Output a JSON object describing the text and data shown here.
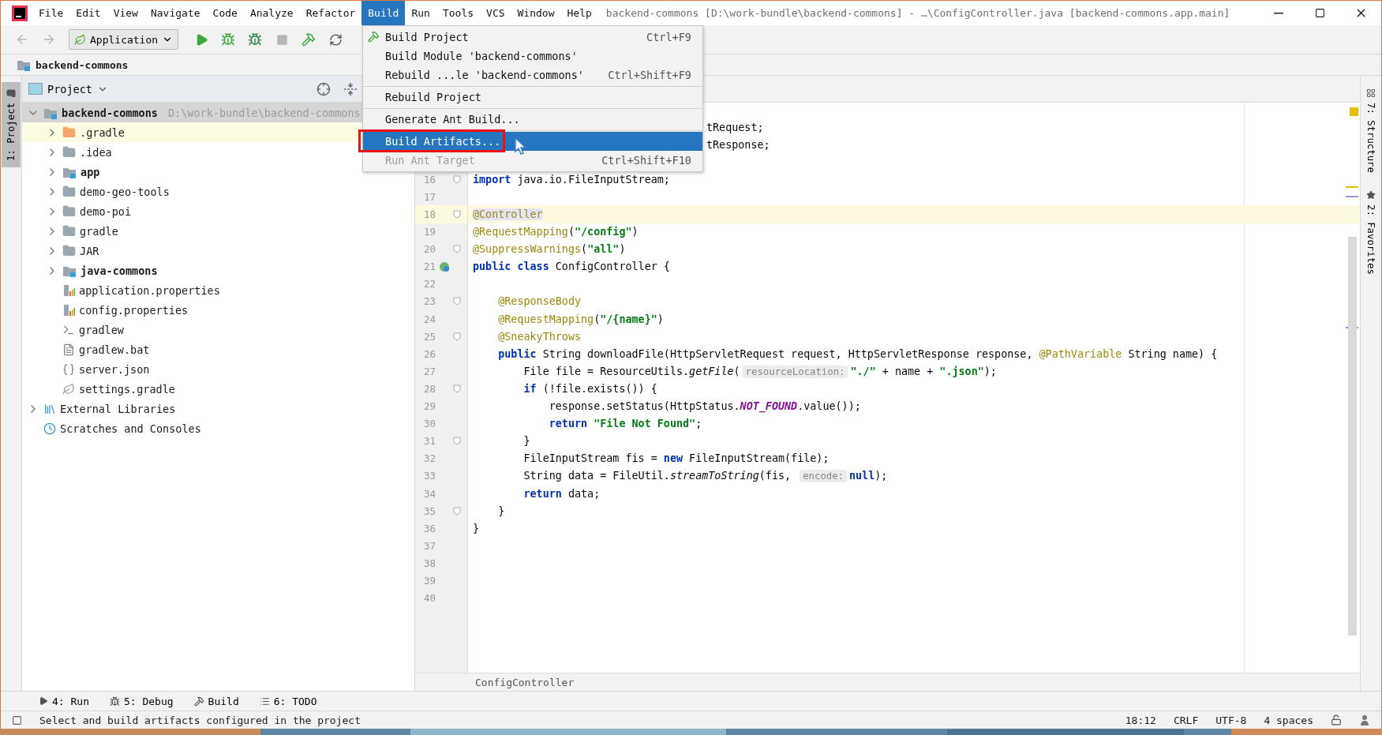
{
  "window": {
    "title": "backend-commons [D:\\work-bundle\\backend-commons] - …\\ConfigController.java [backend-commons.app.main]"
  },
  "menu_bar": [
    {
      "label": "File",
      "selected": false
    },
    {
      "label": "Edit",
      "selected": false
    },
    {
      "label": "View",
      "selected": false
    },
    {
      "label": "Navigate",
      "selected": false
    },
    {
      "label": "Code",
      "selected": false
    },
    {
      "label": "Analyze",
      "selected": false
    },
    {
      "label": "Refactor",
      "selected": false
    },
    {
      "label": "Build",
      "selected": true
    },
    {
      "label": "Run",
      "selected": false
    },
    {
      "label": "Tools",
      "selected": false
    },
    {
      "label": "VCS",
      "selected": false
    },
    {
      "label": "Window",
      "selected": false
    },
    {
      "label": "Help",
      "selected": false
    }
  ],
  "build_menu": [
    {
      "kind": "item",
      "label": "Build Project",
      "shortcut": "Ctrl+F9",
      "selected": false,
      "disabled": false
    },
    {
      "kind": "item",
      "label": "Build Module 'backend-commons'",
      "selected": false,
      "disabled": false
    },
    {
      "kind": "item",
      "label": "Rebuild ...le 'backend-commons'",
      "shortcut": "Ctrl+Shift+F9",
      "selected": false,
      "disabled": false
    },
    {
      "kind": "separator"
    },
    {
      "kind": "item",
      "label": "Rebuild Project",
      "selected": false,
      "disabled": false
    },
    {
      "kind": "separator"
    },
    {
      "kind": "item",
      "label": "Generate Ant Build...",
      "selected": false,
      "disabled": false
    },
    {
      "kind": "separator"
    },
    {
      "kind": "item",
      "label": "Build Artifacts...",
      "selected": true,
      "disabled": false,
      "framed": true
    },
    {
      "kind": "item",
      "label": "Run Ant Target",
      "shortcut": "Ctrl+Shift+F10",
      "selected": false,
      "disabled": true
    }
  ],
  "toolbar": {
    "run_config": "Application",
    "buttons": [
      {
        "kind": "back",
        "disabled": true
      },
      {
        "kind": "forward",
        "disabled": true
      },
      {
        "kind": "config"
      },
      {
        "kind": "run",
        "disabled": false
      },
      {
        "kind": "debug",
        "disabled": false
      },
      {
        "kind": "coverage",
        "disabled": false
      },
      {
        "kind": "stop",
        "disabled": true
      },
      {
        "kind": "build",
        "disabled": false
      },
      {
        "kind": "sync",
        "disabled": false
      }
    ]
  },
  "nav_bar": {
    "label": "backend-commons"
  },
  "left_stripe": [
    {
      "label": "1: Project",
      "selected": true
    }
  ],
  "project_panel": {
    "title": "Project",
    "tree": [
      {
        "name": "backend-commons",
        "hint": "D:\\work-bundle\\backend-commons",
        "kind": "module",
        "bold": true,
        "expanded": true,
        "selected": true,
        "highlighted": false,
        "children": [
          {
            "name": ".gradle",
            "kind": "folder-excluded",
            "bold": false,
            "expanded": false,
            "selected": false,
            "highlighted": true
          },
          {
            "name": ".idea",
            "kind": "folder",
            "bold": false,
            "expanded": false,
            "selected": false,
            "highlighted": false
          },
          {
            "name": "app",
            "kind": "module",
            "bold": true,
            "expanded": false,
            "selected": false,
            "highlighted": false
          },
          {
            "name": "demo-geo-tools",
            "kind": "folder",
            "bold": false,
            "expanded": false,
            "selected": false,
            "highlighted": false
          },
          {
            "name": "demo-poi",
            "kind": "folder",
            "bold": false,
            "expanded": false,
            "selected": false,
            "highlighted": false
          },
          {
            "name": "gradle",
            "kind": "folder",
            "bold": false,
            "expanded": false,
            "selected": false,
            "highlighted": false
          },
          {
            "name": "JAR",
            "kind": "folder",
            "bold": false,
            "expanded": false,
            "selected": false,
            "highlighted": false
          },
          {
            "name": "java-commons",
            "kind": "module",
            "bold": true,
            "expanded": false,
            "selected": false,
            "highlighted": false
          },
          {
            "name": "application.properties",
            "kind": "properties",
            "bold": false,
            "selected": false,
            "highlighted": false
          },
          {
            "name": "config.properties",
            "kind": "properties",
            "bold": false,
            "selected": false,
            "highlighted": false
          },
          {
            "name": "gradlew",
            "kind": "shell",
            "bold": false,
            "selected": false,
            "highlighted": false
          },
          {
            "name": "gradlew.bat",
            "kind": "text",
            "bold": false,
            "selected": false,
            "highlighted": false
          },
          {
            "name": "server.json",
            "kind": "json",
            "bold": false,
            "selected": false,
            "highlighted": false
          },
          {
            "name": "settings.gradle",
            "kind": "gradle",
            "bold": false,
            "selected": false,
            "highlighted": false
          }
        ]
      },
      {
        "name": "External Libraries",
        "kind": "libraries",
        "bold": false,
        "expanded": false,
        "selected": false,
        "highlighted": false
      },
      {
        "name": "Scratches and Consoles",
        "kind": "scratches",
        "bold": false,
        "selected": false,
        "highlighted": false
      }
    ]
  },
  "editor": {
    "lines": [
      {
        "kind": "clipped",
        "tokens": [
          {
            "kind": "plain",
            "text": "tRequest;"
          }
        ]
      },
      {
        "kind": "clipped",
        "tokens": [
          {
            "kind": "plain",
            "text": "tResponse;"
          }
        ]
      },
      {
        "kind": "code",
        "number": "16",
        "current": false,
        "fold": true,
        "gutter_icon": false,
        "tokens": [
          {
            "kind": "keyword",
            "text": "import"
          },
          {
            "kind": "plain",
            "text": " java.io.FileInputStream;"
          }
        ]
      },
      {
        "kind": "code",
        "number": "17",
        "current": false,
        "fold": false,
        "gutter_icon": false
      },
      {
        "kind": "code",
        "number": "18",
        "current": true,
        "fold": true,
        "gutter_icon": false,
        "tokens": [
          {
            "kind": "annotation-match",
            "text": "@Controller"
          }
        ]
      },
      {
        "kind": "code",
        "number": "19",
        "current": false,
        "fold": false,
        "gutter_icon": false,
        "tokens": [
          {
            "kind": "annotation",
            "text": "@RequestMapping"
          },
          {
            "kind": "plain",
            "text": "("
          },
          {
            "kind": "string",
            "text": "\"/config\""
          },
          {
            "kind": "plain",
            "text": ")"
          }
        ]
      },
      {
        "kind": "code",
        "number": "20",
        "current": false,
        "fold": true,
        "gutter_icon": false,
        "tokens": [
          {
            "kind": "annotation",
            "text": "@SuppressWarnings"
          },
          {
            "kind": "plain",
            "text": "("
          },
          {
            "kind": "string",
            "text": "\"all\""
          },
          {
            "kind": "plain",
            "text": ")"
          }
        ]
      },
      {
        "kind": "code",
        "number": "21",
        "current": false,
        "fold": false,
        "gutter_icon": true,
        "tokens": [
          {
            "kind": "keyword",
            "text": "public class"
          },
          {
            "kind": "plain",
            "text": " ConfigController {"
          }
        ]
      },
      {
        "kind": "code",
        "number": "22",
        "current": false,
        "fold": false,
        "gutter_icon": false
      },
      {
        "kind": "code",
        "number": "23",
        "current": false,
        "fold": true,
        "gutter_icon": false,
        "tokens": [
          {
            "kind": "annotation",
            "text": "    @ResponseBody"
          }
        ]
      },
      {
        "kind": "code",
        "number": "24",
        "current": false,
        "fold": false,
        "gutter_icon": false,
        "tokens": [
          {
            "kind": "annotation",
            "text": "    @RequestMapping"
          },
          {
            "kind": "plain",
            "text": "("
          },
          {
            "kind": "string",
            "text": "\"/{name}\""
          },
          {
            "kind": "plain",
            "text": ")"
          }
        ]
      },
      {
        "kind": "code",
        "number": "25",
        "current": false,
        "fold": true,
        "gutter_icon": false,
        "tokens": [
          {
            "kind": "annotation",
            "text": "    @SneakyThrows"
          }
        ]
      },
      {
        "kind": "code",
        "number": "26",
        "current": false,
        "fold": false,
        "gutter_icon": false,
        "tokens": [
          {
            "kind": "keyword",
            "text": "    public"
          },
          {
            "kind": "plain",
            "text": " String downloadFile(HttpServletRequest request, HttpServletResponse response, "
          },
          {
            "kind": "annotation",
            "text": "@PathVariable"
          },
          {
            "kind": "plain",
            "text": " String name) {"
          }
        ]
      },
      {
        "kind": "code",
        "number": "27",
        "current": false,
        "fold": false,
        "gutter_icon": false,
        "tokens": [
          {
            "kind": "plain",
            "text": "        File file = ResourceUtils."
          },
          {
            "kind": "method",
            "text": "getFile"
          },
          {
            "kind": "plain",
            "text": "("
          },
          {
            "kind": "hint",
            "text": "resourceLocation:"
          },
          {
            "kind": "string",
            "text": "\"./\""
          },
          {
            "kind": "plain",
            "text": " + name + "
          },
          {
            "kind": "string",
            "text": "\".json\""
          },
          {
            "kind": "plain",
            "text": ");"
          }
        ]
      },
      {
        "kind": "code",
        "number": "28",
        "current": false,
        "fold": true,
        "gutter_icon": false,
        "tokens": [
          {
            "kind": "keyword",
            "text": "        if"
          },
          {
            "kind": "plain",
            "text": " (!file.exists()) {"
          }
        ]
      },
      {
        "kind": "code",
        "number": "29",
        "current": false,
        "fold": false,
        "gutter_icon": false,
        "tokens": [
          {
            "kind": "plain",
            "text": "            response.setStatus(HttpStatus."
          },
          {
            "kind": "constant",
            "text": "NOT_FOUND"
          },
          {
            "kind": "plain",
            "text": ".value());"
          }
        ]
      },
      {
        "kind": "code",
        "number": "30",
        "current": false,
        "fold": false,
        "gutter_icon": false,
        "tokens": [
          {
            "kind": "keyword",
            "text": "            return"
          },
          {
            "kind": "string",
            "text": " \"File Not Found\""
          },
          {
            "kind": "plain",
            "text": ";"
          }
        ]
      },
      {
        "kind": "code",
        "number": "31",
        "current": false,
        "fold": true,
        "gutter_icon": false,
        "tokens": [
          {
            "kind": "plain",
            "text": "        }"
          }
        ]
      },
      {
        "kind": "code",
        "number": "32",
        "current": false,
        "fold": false,
        "gutter_icon": false,
        "tokens": [
          {
            "kind": "plain",
            "text": "        FileInputStream fis = "
          },
          {
            "kind": "keyword",
            "text": "new"
          },
          {
            "kind": "plain",
            "text": " FileInputStream(file);"
          }
        ]
      },
      {
        "kind": "code",
        "number": "33",
        "current": false,
        "fold": false,
        "gutter_icon": false,
        "tokens": [
          {
            "kind": "plain",
            "text": "        String data = FileUtil."
          },
          {
            "kind": "method",
            "text": "streamToString"
          },
          {
            "kind": "plain",
            "text": "(fis, "
          },
          {
            "kind": "hint",
            "text": "encode:"
          },
          {
            "kind": "keyword",
            "text": "null"
          },
          {
            "kind": "plain",
            "text": ");"
          }
        ]
      },
      {
        "kind": "code",
        "number": "34",
        "current": false,
        "fold": false,
        "gutter_icon": false,
        "tokens": [
          {
            "kind": "keyword",
            "text": "        return"
          },
          {
            "kind": "plain",
            "text": " data;"
          }
        ]
      },
      {
        "kind": "code",
        "number": "35",
        "current": false,
        "fold": true,
        "gutter_icon": false,
        "tokens": [
          {
            "kind": "plain",
            "text": "    }"
          }
        ]
      },
      {
        "kind": "code",
        "number": "36",
        "current": false,
        "fold": false,
        "gutter_icon": false,
        "tokens": [
          {
            "kind": "plain",
            "text": "}"
          }
        ]
      },
      {
        "kind": "code",
        "number": "37",
        "current": false,
        "fold": false,
        "gutter_icon": false
      },
      {
        "kind": "code",
        "number": "38",
        "current": false,
        "fold": false,
        "gutter_icon": false
      },
      {
        "kind": "code",
        "number": "39",
        "current": false,
        "fold": false,
        "gutter_icon": false
      },
      {
        "kind": "code",
        "number": "40",
        "current": false,
        "fold": false,
        "gutter_icon": false
      }
    ],
    "breadcrumb": "ConfigController"
  },
  "right_stripe": [
    {
      "label": "7: Structure",
      "kind": "structure"
    },
    {
      "label": "2: Favorites",
      "kind": "favorites"
    }
  ],
  "tool_windows": [
    {
      "label": "4: Run",
      "kind": "run"
    },
    {
      "label": "5: Debug",
      "kind": "debug"
    },
    {
      "label": "Build",
      "kind": "build"
    },
    {
      "label": "6: TODO",
      "kind": "todo"
    }
  ],
  "status_bar": {
    "message": "Select and build artifacts configured in the project",
    "items": [
      "18:12",
      "CRLF",
      "UTF-8",
      "4 spaces"
    ]
  }
}
